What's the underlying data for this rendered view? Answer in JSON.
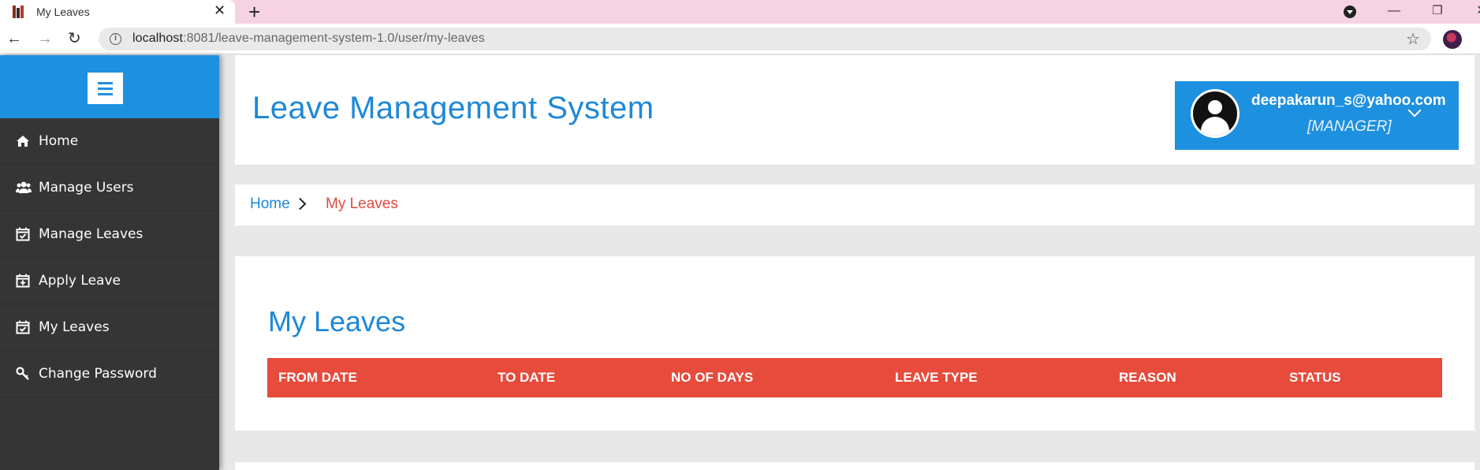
{
  "browser": {
    "tab_title": "My Leaves",
    "tab_close": "✕",
    "new_tab": "+",
    "url_host": "localhost",
    "url_rest": ":8081/leave-management-system-1.0/user/my-leaves",
    "window_controls": {
      "minimize": "—",
      "restore": "❐",
      "close": "✕"
    }
  },
  "sidebar": {
    "items": [
      {
        "label": "Home",
        "icon": "home-icon"
      },
      {
        "label": "Manage Users",
        "icon": "users-icon"
      },
      {
        "label": "Manage Leaves",
        "icon": "calendar-check-icon"
      },
      {
        "label": "Apply Leave",
        "icon": "calendar-plus-icon"
      },
      {
        "label": "My Leaves",
        "icon": "calendar-check-icon"
      },
      {
        "label": "Change Password",
        "icon": "key-icon"
      }
    ]
  },
  "header": {
    "title": "Leave Management System",
    "user_email": "deepakarun_s@yahoo.com",
    "user_role": "[MANAGER]"
  },
  "breadcrumb": {
    "home": "Home",
    "current": "My Leaves"
  },
  "main": {
    "section_title": "My Leaves",
    "columns": [
      "FROM DATE",
      "TO DATE",
      "NO OF DAYS",
      "LEAVE TYPE",
      "REASON",
      "STATUS"
    ]
  },
  "colors": {
    "primary": "#1e90e0",
    "accent_red": "#e64b3c",
    "sidebar_bg": "#353535",
    "tab_bar": "#f5d3e3"
  }
}
